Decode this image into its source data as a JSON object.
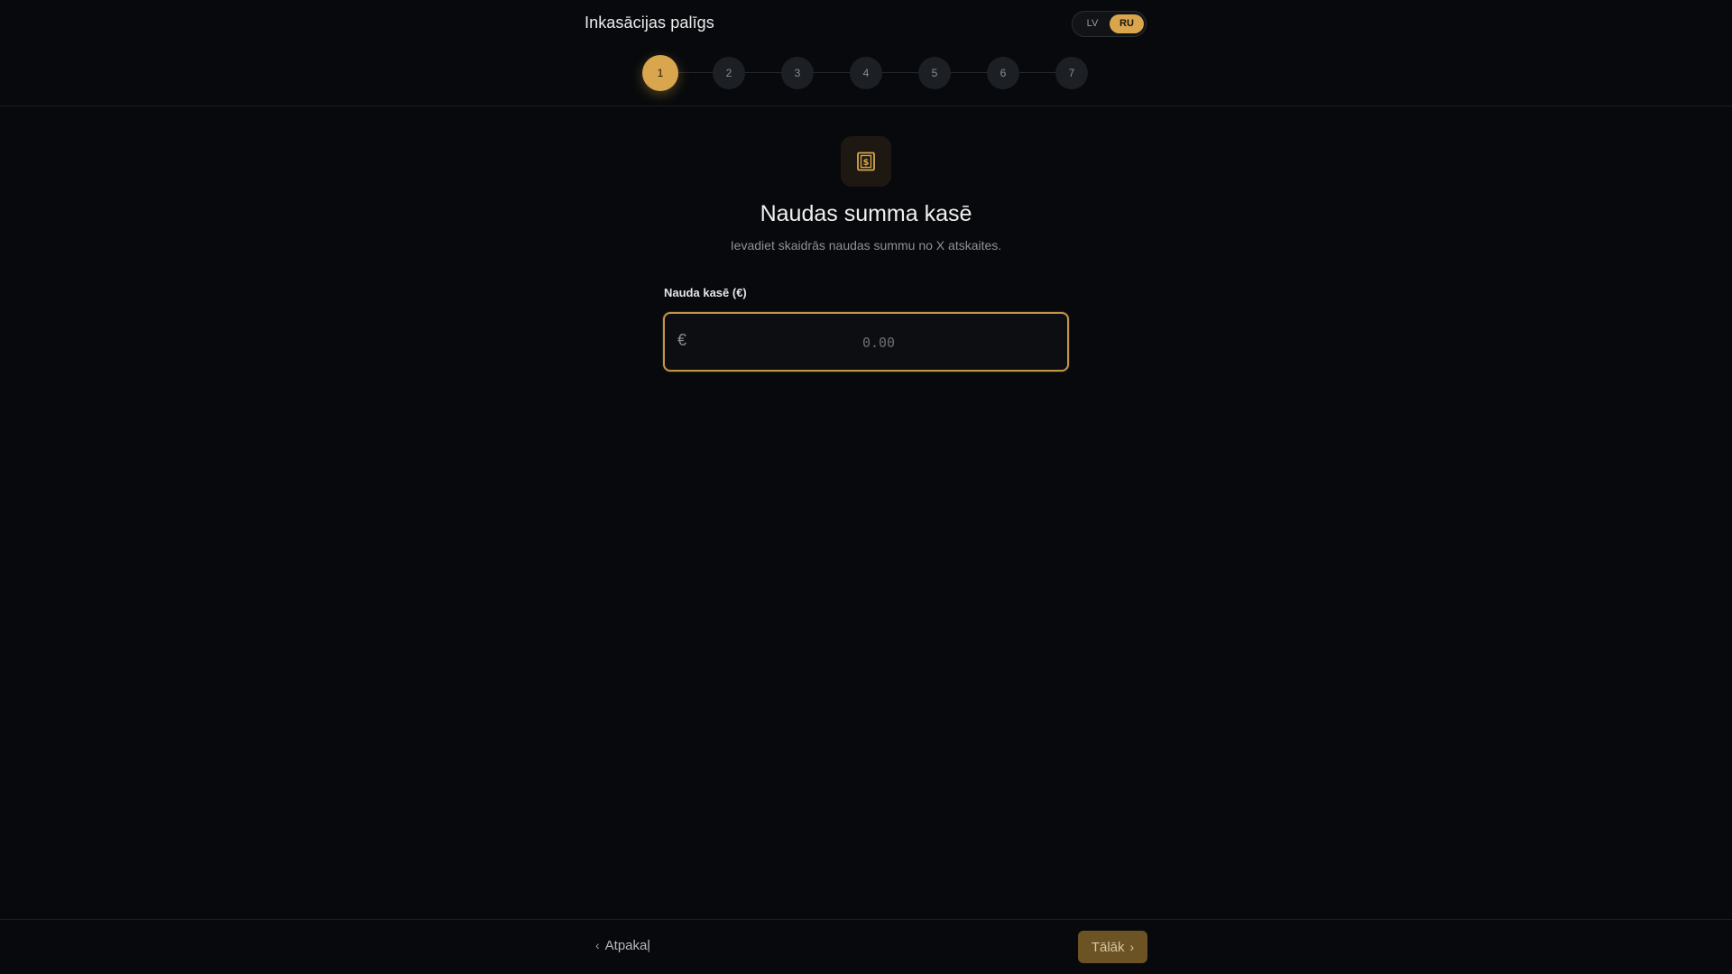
{
  "header": {
    "title": "Inkasācijas palīgs",
    "languages": [
      {
        "code": "LV",
        "active": false
      },
      {
        "code": "RU",
        "active": true
      }
    ]
  },
  "stepper": {
    "current": 1,
    "steps": [
      "1",
      "2",
      "3",
      "4",
      "5",
      "6",
      "7"
    ]
  },
  "main": {
    "icon": "cash-receipt-icon",
    "title": "Naudas summa kasē",
    "subtitle": "Ievadiet skaidrās naudas summu no X atskaites.",
    "field": {
      "label": "Nauda kasē (€)",
      "currency_symbol": "€",
      "value": "",
      "placeholder": "0.00"
    }
  },
  "footer": {
    "back_label": "Atpakaļ",
    "next_label": "Tālāk"
  },
  "colors": {
    "accent": "#d9a54d",
    "background": "#07090c",
    "next_button": "#6b5323"
  }
}
